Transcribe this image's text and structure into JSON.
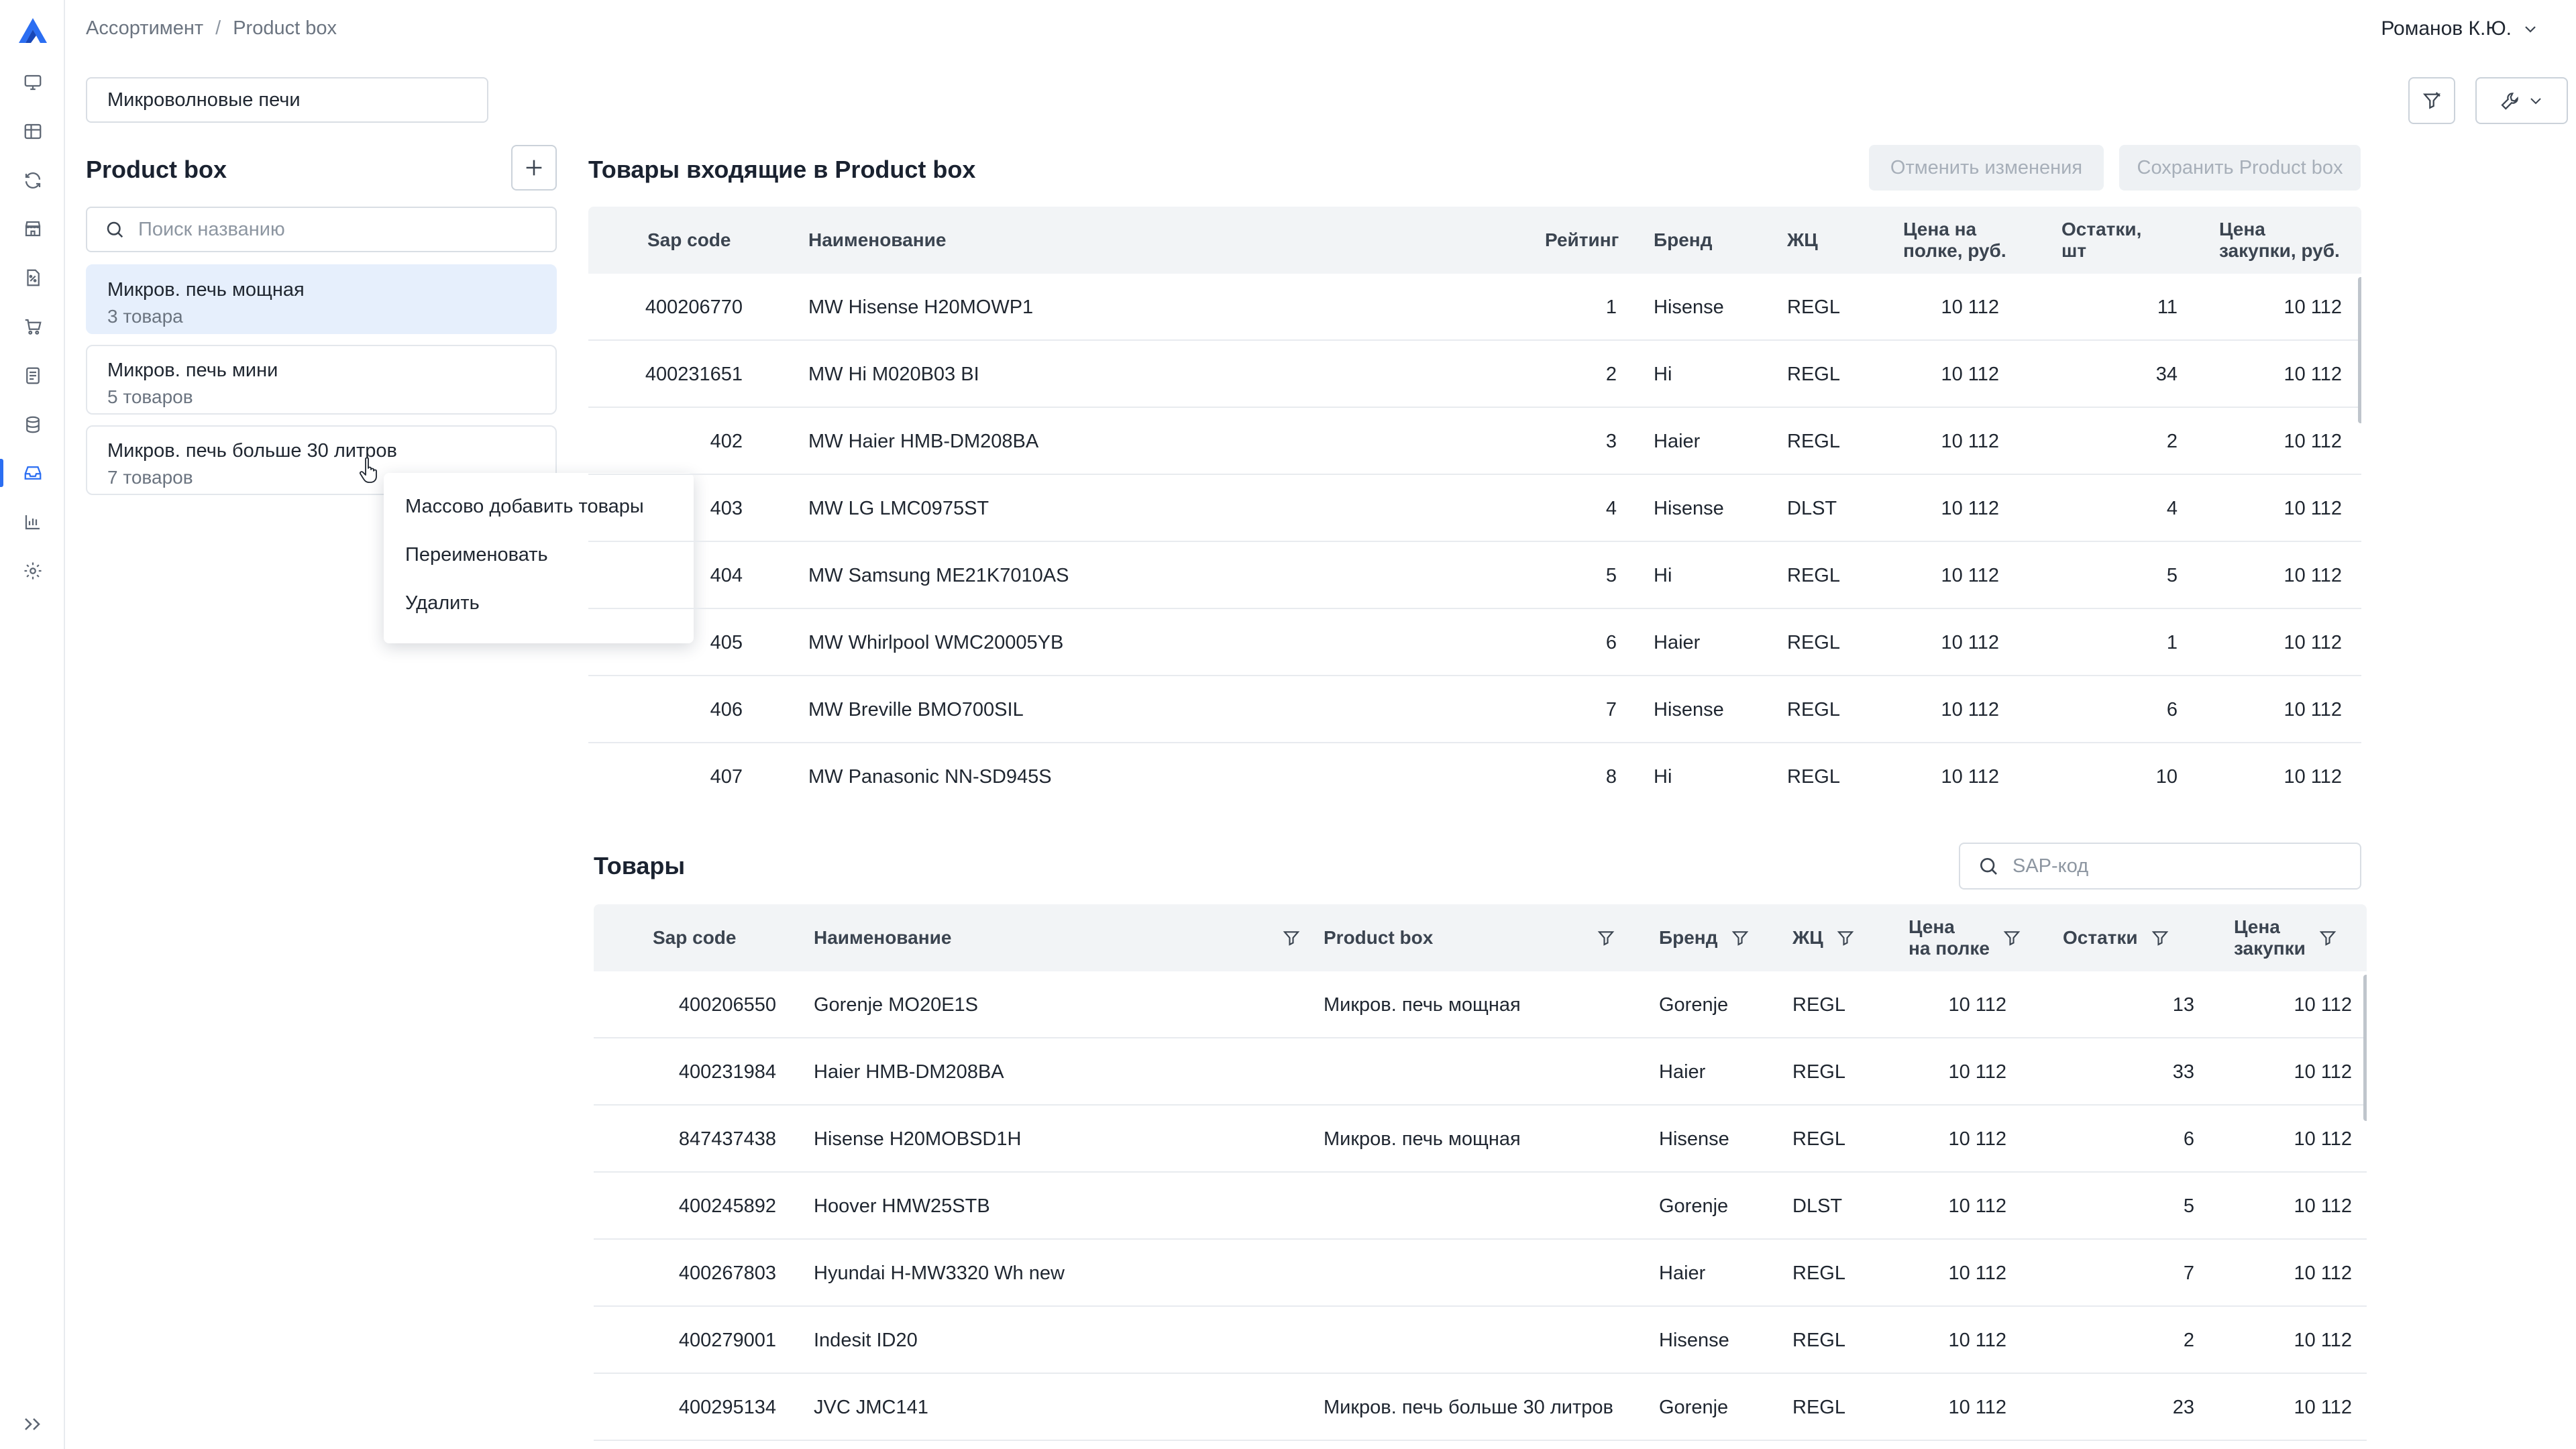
{
  "breadcrumb": {
    "items": [
      "Ассортимент",
      "Product box"
    ],
    "separator": "/"
  },
  "user": {
    "name": "Романов К.Ю."
  },
  "category": {
    "value": "Микроволновые печи"
  },
  "product_box_panel": {
    "title": "Product box",
    "search_placeholder": "Поиск названию",
    "items": [
      {
        "name": "Микров. печь мощная",
        "count": "3 товара",
        "selected": true
      },
      {
        "name": "Микров. печь мини",
        "count": "5 товаров",
        "selected": false
      },
      {
        "name": "Микров. печь больше 30 литров",
        "count": "7 товаров",
        "selected": false
      }
    ]
  },
  "context_menu": {
    "items": [
      "Массово добавить товары",
      "Переименовать",
      "Удалить"
    ]
  },
  "included": {
    "title": "Товары входящие в Product box",
    "cancel_label": "Отменить изменения",
    "save_label": "Сохранить Product box",
    "headers": {
      "sap": "Sap code",
      "name": "Наименование",
      "rating": "Рейтинг",
      "brand": "Бренд",
      "lc": "ЖЦ",
      "shelf_price_1": "Цена на",
      "shelf_price_2": "полке, руб.",
      "stock_1": "Остатки,",
      "stock_2": "шт",
      "purchase_1": "Цена",
      "purchase_2": "закупки, руб."
    },
    "rows": [
      {
        "sap": "400206770",
        "name": "MW Hisense H20MOWP1",
        "rating": "1",
        "brand": "Hisense",
        "lc": "REGL",
        "shelf": "10 112",
        "stock": "11",
        "purchase": "10 112"
      },
      {
        "sap": "400231651",
        "name": "MW Hi M020B03 BI",
        "rating": "2",
        "brand": "Hi",
        "lc": "REGL",
        "shelf": "10 112",
        "stock": "34",
        "purchase": "10 112"
      },
      {
        "sap": "402",
        "name": "MW Haier HMB-DM208BA",
        "rating": "3",
        "brand": "Haier",
        "lc": "REGL",
        "shelf": "10 112",
        "stock": "2",
        "purchase": "10 112"
      },
      {
        "sap": "403",
        "name": "MW LG LMC0975ST",
        "rating": "4",
        "brand": "Hisense",
        "lc": "DLST",
        "shelf": "10 112",
        "stock": "4",
        "purchase": "10 112"
      },
      {
        "sap": "404",
        "name": "MW Samsung ME21K7010AS",
        "rating": "5",
        "brand": "Hi",
        "lc": "REGL",
        "shelf": "10 112",
        "stock": "5",
        "purchase": "10 112"
      },
      {
        "sap": "405",
        "name": "MW Whirlpool WMC20005YB",
        "rating": "6",
        "brand": "Haier",
        "lc": "REGL",
        "shelf": "10 112",
        "stock": "1",
        "purchase": "10 112"
      },
      {
        "sap": "406",
        "name": "MW Breville BMO700SIL",
        "rating": "7",
        "brand": "Hisense",
        "lc": "REGL",
        "shelf": "10 112",
        "stock": "6",
        "purchase": "10 112"
      },
      {
        "sap": "407",
        "name": "MW Panasonic NN-SD945S",
        "rating": "8",
        "brand": "Hi",
        "lc": "REGL",
        "shelf": "10 112",
        "stock": "10",
        "purchase": "10 112"
      }
    ]
  },
  "products": {
    "title": "Товары",
    "search_placeholder": "SAP-код",
    "headers": {
      "sap": "Sap code",
      "name": "Наименование",
      "pbox": "Product box",
      "brand": "Бренд",
      "lc": "ЖЦ",
      "shelf_1": "Цена",
      "shelf_2": "на полке",
      "stock": "Остатки",
      "purchase_1": "Цена",
      "purchase_2": "закупки"
    },
    "rows": [
      {
        "sap": "400206550",
        "name": "Gorenje MO20E1S",
        "pbox": "Микров. печь мощная",
        "brand": "Gorenje",
        "lc": "REGL",
        "shelf": "10 112",
        "stock": "13",
        "purchase": "10 112"
      },
      {
        "sap": "400231984",
        "name": "Haier HMB-DM208BA",
        "pbox": "",
        "brand": "Haier",
        "lc": "REGL",
        "shelf": "10 112",
        "stock": "33",
        "purchase": "10 112"
      },
      {
        "sap": "847437438",
        "name": "Hisense H20MOBSD1H",
        "pbox": "Микров. печь мощная",
        "brand": "Hisense",
        "lc": "REGL",
        "shelf": "10 112",
        "stock": "6",
        "purchase": "10 112"
      },
      {
        "sap": "400245892",
        "name": "Hoover HMW25STB",
        "pbox": "",
        "brand": "Gorenje",
        "lc": "DLST",
        "shelf": "10 112",
        "stock": "5",
        "purchase": "10 112"
      },
      {
        "sap": "400267803",
        "name": "Hyundai H-MW3320 Wh new",
        "pbox": "",
        "brand": "Haier",
        "lc": "REGL",
        "shelf": "10 112",
        "stock": "7",
        "purchase": "10 112"
      },
      {
        "sap": "400279001",
        "name": "Indesit ID20",
        "pbox": "",
        "brand": "Hisense",
        "lc": "REGL",
        "shelf": "10 112",
        "stock": "2",
        "purchase": "10 112"
      },
      {
        "sap": "400295134",
        "name": "JVC JMC141",
        "pbox": "Микров. печь больше 30 литров",
        "brand": "Gorenje",
        "lc": "REGL",
        "shelf": "10 112",
        "stock": "23",
        "purchase": "10 112"
      }
    ]
  },
  "colors": {
    "accent": "#2b6ef2",
    "selected_bg": "#e6effc",
    "header_bg": "#f2f4f6",
    "border": "#e8ebef"
  },
  "icons": {
    "rail": [
      "monitor-icon",
      "grid-icon",
      "refresh-icon",
      "store-icon",
      "percent-doc-icon",
      "cart-icon",
      "list-doc-icon",
      "database-icon",
      "inbox-icon",
      "bar-chart-icon",
      "gear-icon"
    ],
    "toolbar": [
      "filter-off-icon",
      "wrench-icon",
      "chevron-down-icon"
    ]
  }
}
